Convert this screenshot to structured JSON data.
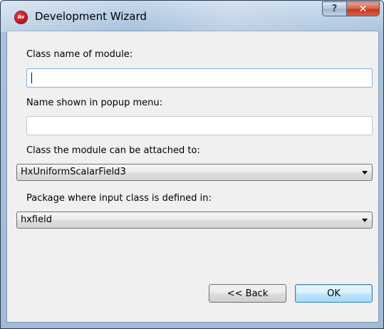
{
  "window": {
    "title": "Development Wizard",
    "icon_text": "Av",
    "help_glyph": "?",
    "close_glyph": "✕"
  },
  "form": {
    "class_name_label": "Class name of module:",
    "class_name_value": "",
    "popup_name_label": "Name shown in popup menu:",
    "popup_name_value": "",
    "attach_class_label": "Class the module can be attached to:",
    "attach_class_value": "HxUniformScalarField3",
    "package_label": "Package where input class is defined in:",
    "package_value": "hxfield"
  },
  "buttons": {
    "back_label": "<< Back",
    "ok_label": "OK"
  },
  "colors": {
    "title_glass": "#a9c2dc",
    "close_button": "#c2381d",
    "dialog_background": "#f0f0f0",
    "focus_border": "#7eb4ea",
    "default_button_border": "#3c7fb1"
  }
}
